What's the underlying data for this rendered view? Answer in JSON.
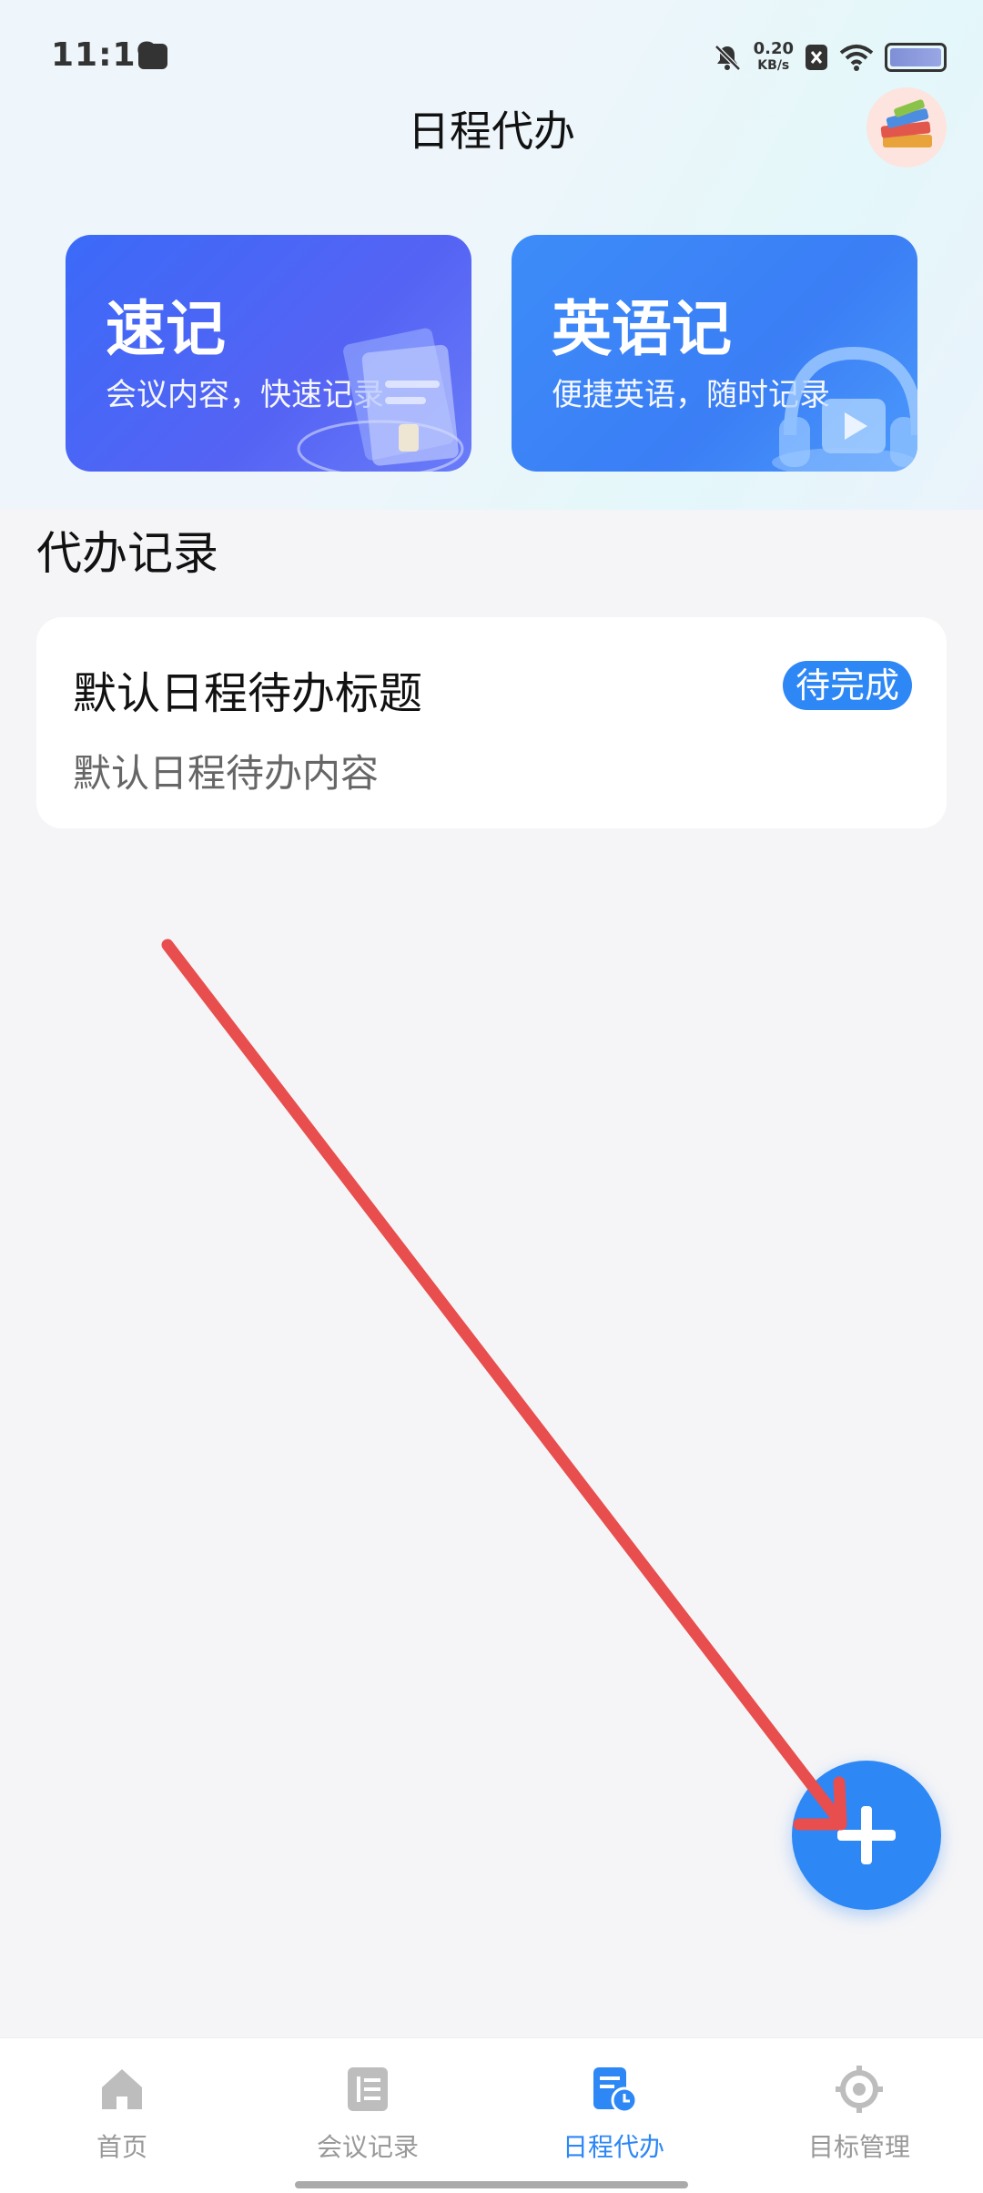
{
  "status_bar": {
    "time": "11:19",
    "speed_value": "0.20",
    "speed_unit": "KB/s"
  },
  "header": {
    "title": "日程代办"
  },
  "feature_cards": [
    {
      "title": "速记",
      "subtitle": "会议内容，快速记录"
    },
    {
      "title": "英语记",
      "subtitle": "便捷英语，随时记录"
    }
  ],
  "section": {
    "title": "代办记录"
  },
  "todo_items": [
    {
      "title": "默认日程待办标题",
      "content": "默认日程待办内容",
      "status": "待完成"
    }
  ],
  "bottom_nav": [
    {
      "label": "首页",
      "icon": "home-icon",
      "active": false
    },
    {
      "label": "会议记录",
      "icon": "meeting-record-icon",
      "active": false
    },
    {
      "label": "日程代办",
      "icon": "schedule-todo-icon",
      "active": true
    },
    {
      "label": "目标管理",
      "icon": "target-icon",
      "active": false
    }
  ],
  "colors": {
    "accent": "#2d87f5",
    "card1": "#4a63f6",
    "card2": "#3b84f7",
    "annotation_arrow": "#e84e4e"
  }
}
